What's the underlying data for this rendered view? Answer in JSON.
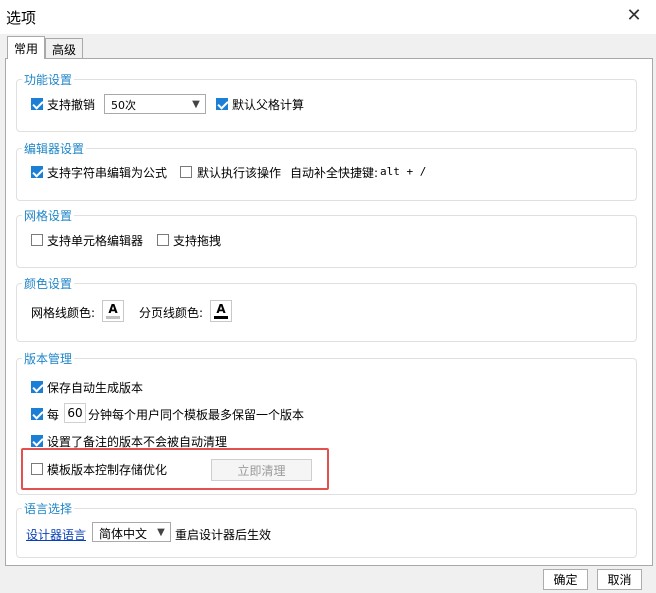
{
  "window": {
    "title": "选项",
    "close_icon": "close-icon"
  },
  "tabs": [
    {
      "label": "常用",
      "active": true
    },
    {
      "label": "高级",
      "active": false
    }
  ],
  "function_settings": {
    "title": "功能设置",
    "undo": {
      "label": "支持撤销",
      "checked": true
    },
    "undo_steps": {
      "value": "50次"
    },
    "default_parent": {
      "label": "默认父格计算",
      "checked": true
    }
  },
  "editor_settings": {
    "title": "编辑器设置",
    "string_as_formula": {
      "label": "支持字符串编辑为公式",
      "checked": true
    },
    "default_execute": {
      "label": "默认执行该操作",
      "checked": false
    },
    "autocomplete_label": "自动补全快捷键:",
    "autocomplete_shortcut": "alt + /"
  },
  "grid_settings": {
    "title": "网格设置",
    "cell_editor": {
      "label": "支持单元格编辑器",
      "checked": false
    },
    "drag": {
      "label": "支持拖拽",
      "checked": false
    }
  },
  "color_settings": {
    "title": "颜色设置",
    "grid_line_label": "网格线颜色:",
    "page_line_label": "分页线颜色:",
    "grid_line_color": "#c0c0c0",
    "page_line_color": "#000000"
  },
  "version_mgmt": {
    "title": "版本管理",
    "auto_save": {
      "label": "保存自动生成版本",
      "checked": true
    },
    "every_prefix": "每",
    "minutes": "60",
    "every_suffix": "分钟每个用户同个模板最多保留一个版本",
    "every_checked": true,
    "no_auto_clean": {
      "label": "设置了备注的版本不会被自动清理",
      "checked": true
    },
    "storage_opt": {
      "label": "模板版本控制存储优化",
      "checked": false
    },
    "clean_now": "立即清理",
    "highlight_color": "#e35050"
  },
  "language": {
    "title": "语言选择",
    "designer_language": "设计器语言",
    "selected": "简体中文",
    "restart_note": "重启设计器后生效"
  },
  "footer": {
    "ok": "确定",
    "cancel": "取消"
  }
}
